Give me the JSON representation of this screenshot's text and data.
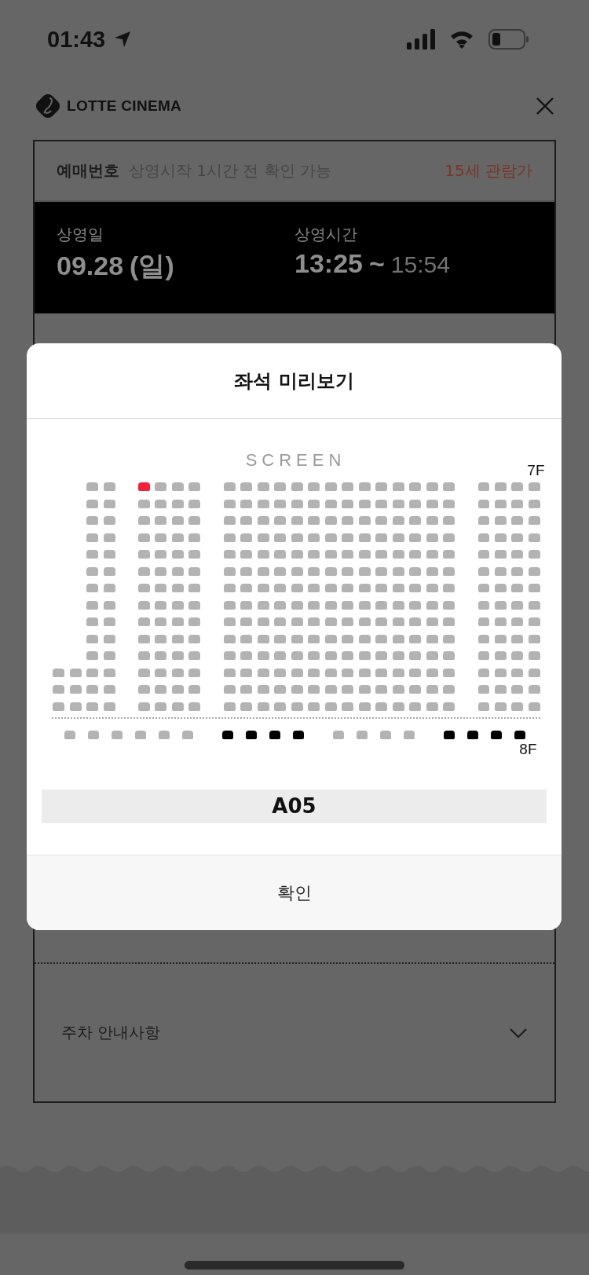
{
  "status_bar": {
    "time": "01:43"
  },
  "header": {
    "brand": "LOTTE CINEMA"
  },
  "ticket": {
    "booking_label": "예매번호",
    "booking_note": "상영시작 1시간 전 확인 가능",
    "rating": "15세 관람가",
    "date_label": "상영일",
    "date": "09.28",
    "weekday": "(일)",
    "time_label": "상영시간",
    "start": "13:25",
    "tilde": "~",
    "end": "15:54",
    "sections": [
      {
        "label": "주차 안내사항",
        "expanded": false
      }
    ]
  },
  "modal": {
    "title": "좌석 미리보기",
    "screen": "SCREEN",
    "upper_floor": {
      "label": "7F",
      "rows": [
        {
          "blocks": [
            [
              {
                "selected": false
              },
              {
                "selected": false
              }
            ],
            [
              {
                "selected": true
              },
              {
                "selected": false
              },
              {
                "selected": false
              },
              {
                "selected": false
              }
            ],
            [
              {
                "selected": false
              },
              {
                "selected": false
              },
              {
                "selected": false
              },
              {
                "selected": false
              },
              {
                "selected": false
              },
              {
                "selected": false
              },
              {
                "selected": false
              },
              {
                "selected": false
              },
              {
                "selected": false
              },
              {
                "selected": false
              },
              {
                "selected": false
              },
              {
                "selected": false
              },
              {
                "selected": false
              },
              {
                "selected": false
              }
            ],
            [
              {
                "selected": false
              },
              {
                "selected": false
              },
              {
                "selected": false
              },
              {
                "selected": false
              }
            ]
          ]
        },
        {
          "blocks": [
            [
              {
                "selected": false
              },
              {
                "selected": false
              }
            ],
            [
              {
                "selected": false
              },
              {
                "selected": false
              },
              {
                "selected": false
              },
              {
                "selected": false
              }
            ],
            [
              {
                "selected": false
              },
              {
                "selected": false
              },
              {
                "selected": false
              },
              {
                "selected": false
              },
              {
                "selected": false
              },
              {
                "selected": false
              },
              {
                "selected": false
              },
              {
                "selected": false
              },
              {
                "selected": false
              },
              {
                "selected": false
              },
              {
                "selected": false
              },
              {
                "selected": false
              },
              {
                "selected": false
              },
              {
                "selected": false
              }
            ],
            [
              {
                "selected": false
              },
              {
                "selected": false
              },
              {
                "selected": false
              },
              {
                "selected": false
              }
            ]
          ]
        },
        {
          "blocks": [
            [
              {
                "selected": false
              },
              {
                "selected": false
              }
            ],
            [
              {
                "selected": false
              },
              {
                "selected": false
              },
              {
                "selected": false
              },
              {
                "selected": false
              }
            ],
            [
              {
                "selected": false
              },
              {
                "selected": false
              },
              {
                "selected": false
              },
              {
                "selected": false
              },
              {
                "selected": false
              },
              {
                "selected": false
              },
              {
                "selected": false
              },
              {
                "selected": false
              },
              {
                "selected": false
              },
              {
                "selected": false
              },
              {
                "selected": false
              },
              {
                "selected": false
              },
              {
                "selected": false
              },
              {
                "selected": false
              }
            ],
            [
              {
                "selected": false
              },
              {
                "selected": false
              },
              {
                "selected": false
              },
              {
                "selected": false
              }
            ]
          ]
        },
        {
          "blocks": [
            [
              {
                "selected": false
              },
              {
                "selected": false
              }
            ],
            [
              {
                "selected": false
              },
              {
                "selected": false
              },
              {
                "selected": false
              },
              {
                "selected": false
              }
            ],
            [
              {
                "selected": false
              },
              {
                "selected": false
              },
              {
                "selected": false
              },
              {
                "selected": false
              },
              {
                "selected": false
              },
              {
                "selected": false
              },
              {
                "selected": false
              },
              {
                "selected": false
              },
              {
                "selected": false
              },
              {
                "selected": false
              },
              {
                "selected": false
              },
              {
                "selected": false
              },
              {
                "selected": false
              },
              {
                "selected": false
              }
            ],
            [
              {
                "selected": false
              },
              {
                "selected": false
              },
              {
                "selected": false
              },
              {
                "selected": false
              }
            ]
          ]
        },
        {
          "blocks": [
            [
              {
                "selected": false
              },
              {
                "selected": false
              }
            ],
            [
              {
                "selected": false
              },
              {
                "selected": false
              },
              {
                "selected": false
              },
              {
                "selected": false
              }
            ],
            [
              {
                "selected": false
              },
              {
                "selected": false
              },
              {
                "selected": false
              },
              {
                "selected": false
              },
              {
                "selected": false
              },
              {
                "selected": false
              },
              {
                "selected": false
              },
              {
                "selected": false
              },
              {
                "selected": false
              },
              {
                "selected": false
              },
              {
                "selected": false
              },
              {
                "selected": false
              },
              {
                "selected": false
              },
              {
                "selected": false
              }
            ],
            [
              {
                "selected": false
              },
              {
                "selected": false
              },
              {
                "selected": false
              },
              {
                "selected": false
              }
            ]
          ]
        },
        {
          "blocks": [
            [
              {
                "selected": false
              },
              {
                "selected": false
              }
            ],
            [
              {
                "selected": false
              },
              {
                "selected": false
              },
              {
                "selected": false
              },
              {
                "selected": false
              }
            ],
            [
              {
                "selected": false
              },
              {
                "selected": false
              },
              {
                "selected": false
              },
              {
                "selected": false
              },
              {
                "selected": false
              },
              {
                "selected": false
              },
              {
                "selected": false
              },
              {
                "selected": false
              },
              {
                "selected": false
              },
              {
                "selected": false
              },
              {
                "selected": false
              },
              {
                "selected": false
              },
              {
                "selected": false
              },
              {
                "selected": false
              }
            ],
            [
              {
                "selected": false
              },
              {
                "selected": false
              },
              {
                "selected": false
              },
              {
                "selected": false
              }
            ]
          ]
        },
        {
          "blocks": [
            [
              {
                "selected": false
              },
              {
                "selected": false
              }
            ],
            [
              {
                "selected": false
              },
              {
                "selected": false
              },
              {
                "selected": false
              },
              {
                "selected": false
              }
            ],
            [
              {
                "selected": false
              },
              {
                "selected": false
              },
              {
                "selected": false
              },
              {
                "selected": false
              },
              {
                "selected": false
              },
              {
                "selected": false
              },
              {
                "selected": false
              },
              {
                "selected": false
              },
              {
                "selected": false
              },
              {
                "selected": false
              },
              {
                "selected": false
              },
              {
                "selected": false
              },
              {
                "selected": false
              },
              {
                "selected": false
              }
            ],
            [
              {
                "selected": false
              },
              {
                "selected": false
              },
              {
                "selected": false
              },
              {
                "selected": false
              }
            ]
          ]
        },
        {
          "blocks": [
            [
              {
                "selected": false
              },
              {
                "selected": false
              }
            ],
            [
              {
                "selected": false
              },
              {
                "selected": false
              },
              {
                "selected": false
              },
              {
                "selected": false
              }
            ],
            [
              {
                "selected": false
              },
              {
                "selected": false
              },
              {
                "selected": false
              },
              {
                "selected": false
              },
              {
                "selected": false
              },
              {
                "selected": false
              },
              {
                "selected": false
              },
              {
                "selected": false
              },
              {
                "selected": false
              },
              {
                "selected": false
              },
              {
                "selected": false
              },
              {
                "selected": false
              },
              {
                "selected": false
              },
              {
                "selected": false
              }
            ],
            [
              {
                "selected": false
              },
              {
                "selected": false
              },
              {
                "selected": false
              },
              {
                "selected": false
              }
            ]
          ]
        },
        {
          "blocks": [
            [
              {
                "selected": false
              },
              {
                "selected": false
              }
            ],
            [
              {
                "selected": false
              },
              {
                "selected": false
              },
              {
                "selected": false
              },
              {
                "selected": false
              }
            ],
            [
              {
                "selected": false
              },
              {
                "selected": false
              },
              {
                "selected": false
              },
              {
                "selected": false
              },
              {
                "selected": false
              },
              {
                "selected": false
              },
              {
                "selected": false
              },
              {
                "selected": false
              },
              {
                "selected": false
              },
              {
                "selected": false
              },
              {
                "selected": false
              },
              {
                "selected": false
              },
              {
                "selected": false
              },
              {
                "selected": false
              }
            ],
            [
              {
                "selected": false
              },
              {
                "selected": false
              },
              {
                "selected": false
              },
              {
                "selected": false
              }
            ]
          ]
        },
        {
          "blocks": [
            [
              {
                "selected": false
              },
              {
                "selected": false
              }
            ],
            [
              {
                "selected": false
              },
              {
                "selected": false
              },
              {
                "selected": false
              },
              {
                "selected": false
              }
            ],
            [
              {
                "selected": false
              },
              {
                "selected": false
              },
              {
                "selected": false
              },
              {
                "selected": false
              },
              {
                "selected": false
              },
              {
                "selected": false
              },
              {
                "selected": false
              },
              {
                "selected": false
              },
              {
                "selected": false
              },
              {
                "selected": false
              },
              {
                "selected": false
              },
              {
                "selected": false
              },
              {
                "selected": false
              },
              {
                "selected": false
              }
            ],
            [
              {
                "selected": false
              },
              {
                "selected": false
              },
              {
                "selected": false
              },
              {
                "selected": false
              }
            ]
          ]
        },
        {
          "blocks": [
            [
              {
                "selected": false
              },
              {
                "selected": false
              }
            ],
            [
              {
                "selected": false
              },
              {
                "selected": false
              },
              {
                "selected": false
              },
              {
                "selected": false
              }
            ],
            [
              {
                "selected": false
              },
              {
                "selected": false
              },
              {
                "selected": false
              },
              {
                "selected": false
              },
              {
                "selected": false
              },
              {
                "selected": false
              },
              {
                "selected": false
              },
              {
                "selected": false
              },
              {
                "selected": false
              },
              {
                "selected": false
              },
              {
                "selected": false
              },
              {
                "selected": false
              },
              {
                "selected": false
              },
              {
                "selected": false
              }
            ],
            [
              {
                "selected": false
              },
              {
                "selected": false
              },
              {
                "selected": false
              },
              {
                "selected": false
              }
            ]
          ]
        },
        {
          "blocks": [
            [
              {
                "selected": false
              },
              {
                "selected": false
              },
              {
                "selected": false
              },
              {
                "selected": false
              }
            ],
            [
              {
                "selected": false
              },
              {
                "selected": false
              },
              {
                "selected": false
              },
              {
                "selected": false
              }
            ],
            [
              {
                "selected": false
              },
              {
                "selected": false
              },
              {
                "selected": false
              },
              {
                "selected": false
              },
              {
                "selected": false
              },
              {
                "selected": false
              },
              {
                "selected": false
              },
              {
                "selected": false
              },
              {
                "selected": false
              },
              {
                "selected": false
              },
              {
                "selected": false
              },
              {
                "selected": false
              },
              {
                "selected": false
              },
              {
                "selected": false
              }
            ],
            [
              {
                "selected": false
              },
              {
                "selected": false
              },
              {
                "selected": false
              },
              {
                "selected": false
              }
            ]
          ]
        },
        {
          "blocks": [
            [
              {
                "selected": false
              },
              {
                "selected": false
              },
              {
                "selected": false
              },
              {
                "selected": false
              }
            ],
            [
              {
                "selected": false
              },
              {
                "selected": false
              },
              {
                "selected": false
              },
              {
                "selected": false
              }
            ],
            [
              {
                "selected": false
              },
              {
                "selected": false
              },
              {
                "selected": false
              },
              {
                "selected": false
              },
              {
                "selected": false
              },
              {
                "selected": false
              },
              {
                "selected": false
              },
              {
                "selected": false
              },
              {
                "selected": false
              },
              {
                "selected": false
              },
              {
                "selected": false
              },
              {
                "selected": false
              },
              {
                "selected": false
              },
              {
                "selected": false
              }
            ],
            [
              {
                "selected": false
              },
              {
                "selected": false
              },
              {
                "selected": false
              },
              {
                "selected": false
              }
            ]
          ]
        },
        {
          "blocks": [
            [
              {
                "selected": false
              },
              {
                "selected": false
              },
              {
                "selected": false
              },
              {
                "selected": false
              }
            ],
            [
              {
                "selected": false
              },
              {
                "selected": false
              },
              {
                "selected": false
              },
              {
                "selected": false
              }
            ],
            [
              {
                "selected": false
              },
              {
                "selected": false
              },
              {
                "selected": false
              },
              {
                "selected": false
              },
              {
                "selected": false
              },
              {
                "selected": false
              },
              {
                "selected": false
              },
              {
                "selected": false
              },
              {
                "selected": false
              },
              {
                "selected": false
              },
              {
                "selected": false
              },
              {
                "selected": false
              },
              {
                "selected": false
              },
              {
                "selected": false
              }
            ],
            [
              {
                "selected": false
              },
              {
                "selected": false
              },
              {
                "selected": false
              },
              {
                "selected": false
              }
            ]
          ]
        }
      ]
    },
    "lower_floor": {
      "label": "8F",
      "blocks": [
        [
          {
            "kind": "regular",
            "selected": false
          },
          {
            "kind": "regular",
            "selected": false
          },
          {
            "kind": "regular",
            "selected": false
          },
          {
            "kind": "regular",
            "selected": false
          },
          {
            "kind": "regular",
            "selected": false
          },
          {
            "kind": "regular",
            "selected": false
          }
        ],
        [
          {
            "kind": "special",
            "selected": false
          },
          {
            "kind": "special",
            "selected": false
          },
          {
            "kind": "special",
            "selected": false
          },
          {
            "kind": "special",
            "selected": false
          }
        ],
        [
          {
            "kind": "regular",
            "selected": false
          },
          {
            "kind": "regular",
            "selected": false
          },
          {
            "kind": "regular",
            "selected": false
          },
          {
            "kind": "regular",
            "selected": false
          }
        ],
        [
          {
            "kind": "special",
            "selected": false
          },
          {
            "kind": "special",
            "selected": false
          },
          {
            "kind": "special",
            "selected": false
          },
          {
            "kind": "special",
            "selected": false
          }
        ]
      ]
    },
    "seat_label": "A05",
    "confirm": "확인"
  }
}
